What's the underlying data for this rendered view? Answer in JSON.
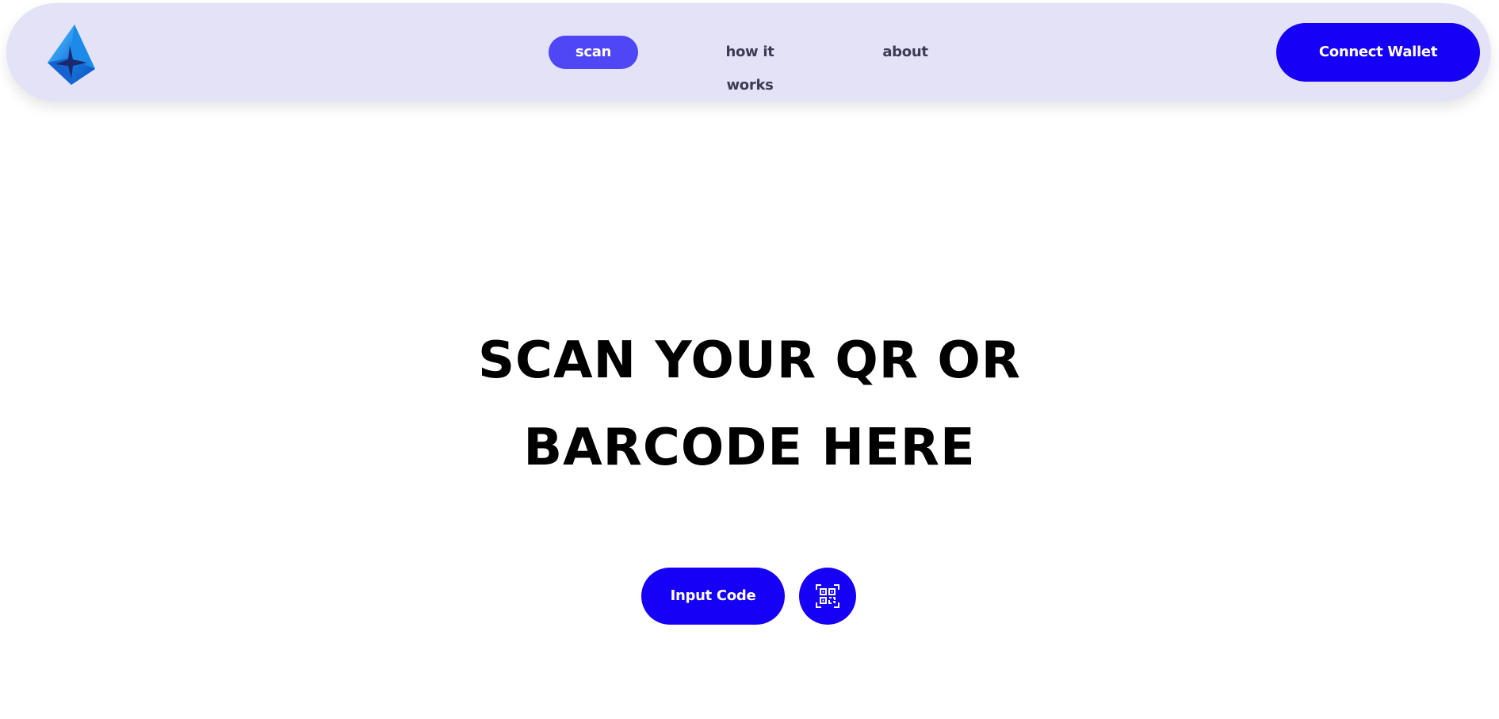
{
  "nav": {
    "links": [
      {
        "label": "scan",
        "active": true
      },
      {
        "label": "how it works",
        "active": false
      },
      {
        "label": "about",
        "active": false
      }
    ],
    "connect_label": "Connect Wallet",
    "logo_icon": "crystal-logo-icon"
  },
  "hero": {
    "title_line1": "SCAN YOUR QR OR",
    "title_line2": "BARCODE HERE"
  },
  "actions": {
    "input_label": "Input Code",
    "qr_icon": "qr-code-icon"
  },
  "colors": {
    "navbar_bg": "#e3e2f6",
    "accent": "#1600f5",
    "active_tab": "#4f46f5"
  }
}
